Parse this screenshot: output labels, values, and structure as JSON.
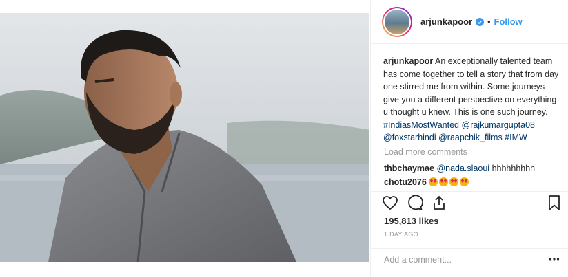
{
  "post": {
    "username": "arjunkapoor",
    "follow_label": "Follow",
    "separator": "•",
    "caption_username": "arjunkapoor",
    "caption_text": "An exceptionally talented team has come together to tell a story that from day one stirred me from within. Some journeys give you a different perspective on everything u thought u knew. This is one such journey.",
    "hashtag1": "#IndiasMostWanted",
    "mention1": "@rajkumargupta08",
    "mention2": "@foxstarhindi",
    "mention3": "@raapchik_films",
    "hashtag2": "#IMW",
    "load_more": "Load more comments",
    "comments": [
      {
        "user": "thbchaymae",
        "mention": "@nada.slaoui",
        "text": "hhhhhhhhh"
      },
      {
        "user": "chotu2076",
        "emoji_count": 4,
        "emoji_name": "heart-eyes-emoji"
      }
    ],
    "likes": "195,813 likes",
    "time": "1 DAY AGO",
    "add_comment_placeholder": "Add a comment...",
    "icons": [
      "heart-icon",
      "comment-icon",
      "share-icon",
      "bookmark-icon",
      "more-options-icon",
      "verified-badge-icon"
    ],
    "colors": {
      "link": "#003569",
      "follow": "#3897f0",
      "muted": "#999999",
      "verified": "#3897f0"
    }
  }
}
